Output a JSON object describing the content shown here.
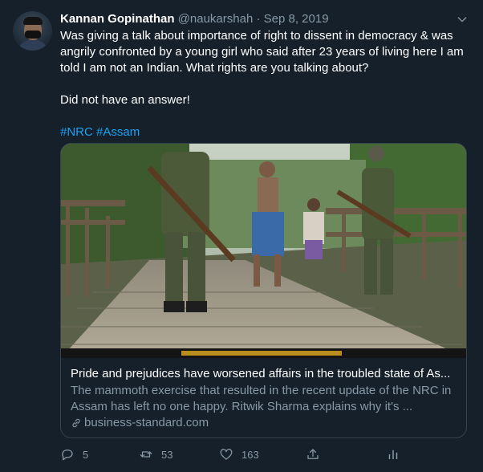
{
  "tweet": {
    "author_name": "Kannan Gopinathan",
    "handle": "@naukarshah",
    "separator": "·",
    "date": "Sep 8, 2019",
    "paragraph1": "Was giving a talk about importance of right to dissent in democracy & was angrily confronted by a young girl who said after 23 years of living here I am told I am not an Indian. What rights are you talking about?",
    "paragraph2": "Did not have an answer!",
    "hashtags": "#NRC #Assam"
  },
  "card": {
    "title": "Pride and prejudices have worsened affairs in the troubled state of As...",
    "description": "The mammoth exercise that resulted in the recent update of the NRC in Assam has left no one happy. Ritwik Sharma explains why it's ...",
    "domain": "business-standard.com"
  },
  "actions": {
    "replies": "5",
    "retweets": "53",
    "likes": "163"
  },
  "colors": {
    "background": "#15202b",
    "text": "#ffffff",
    "secondary": "#8899a6",
    "accent": "#1da1f2",
    "border": "#38444d"
  },
  "icons": [
    "avatar",
    "chevron-down-icon",
    "link-icon",
    "reply-icon",
    "retweet-icon",
    "like-icon",
    "share-icon",
    "analytics-icon"
  ]
}
